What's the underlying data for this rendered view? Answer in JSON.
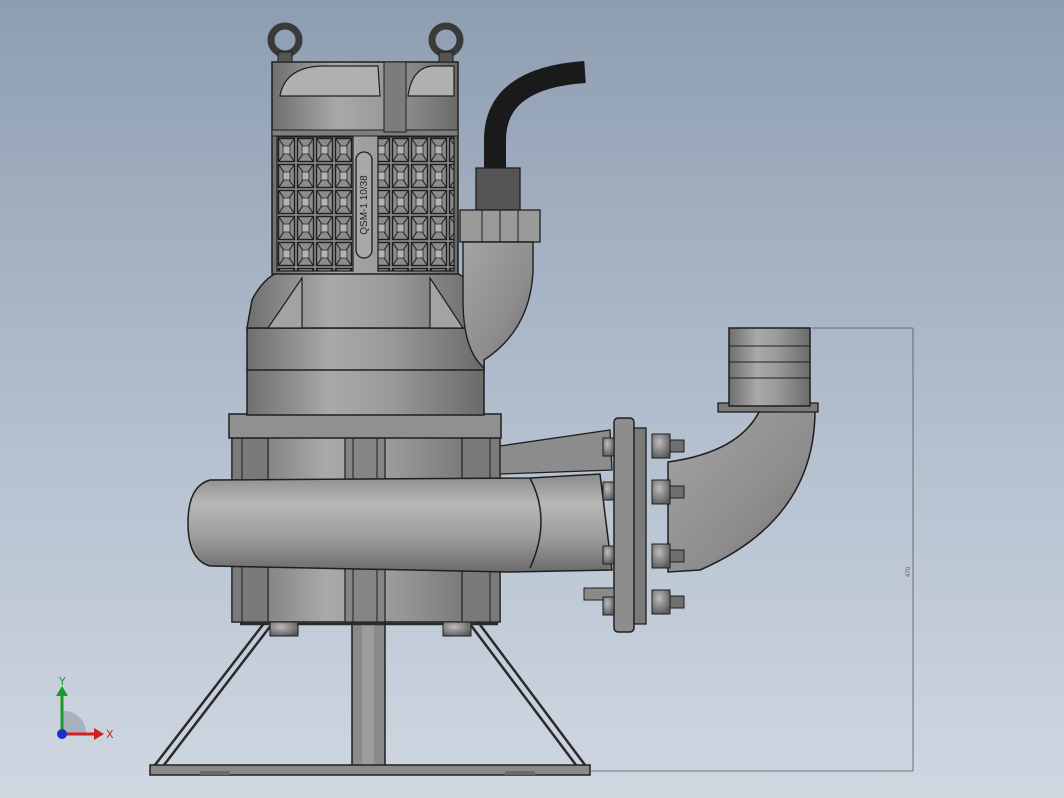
{
  "nameplate": {
    "text": "QSM-1 10/38"
  },
  "dimension": {
    "text": "470"
  },
  "triad": {
    "x_label": "X",
    "y_label": "Y",
    "x_color": "#d12020",
    "y_color": "#1e9a2a",
    "z_color": "#1b2fc9"
  },
  "colors": {
    "metal": "#8f8f8f",
    "metal_dark": "#6e6e6e",
    "metal_light": "#b5b5b5",
    "cable": "#1a1a1a",
    "outline": "#1f1f1f",
    "background_top": "#8e9db1",
    "background_bottom": "#cfd7e1"
  }
}
